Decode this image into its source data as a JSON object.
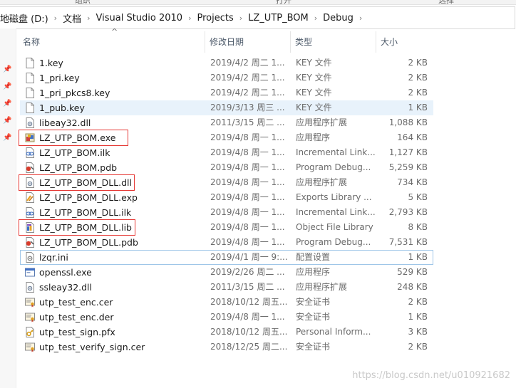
{
  "breadcrumb": [
    "地磁盘 (D:)",
    "文档",
    "Visual Studio 2010",
    "Projects",
    "LZ_UTP_BOM",
    "Debug"
  ],
  "ribbon_fragments": [
    "组织",
    "打开",
    "选择"
  ],
  "columns": {
    "name": "名称",
    "date": "修改日期",
    "type": "类型",
    "size": "大小"
  },
  "files": [
    {
      "name": "1.key",
      "date": "2019/4/2 周二 1...",
      "type": "KEY 文件",
      "size": "2 KB",
      "icon": "document-icon"
    },
    {
      "name": "1_pri.key",
      "date": "2019/4/2 周二 1...",
      "type": "KEY 文件",
      "size": "2 KB",
      "icon": "document-icon"
    },
    {
      "name": "1_pri_pkcs8.key",
      "date": "2019/4/2 周二 1...",
      "type": "KEY 文件",
      "size": "2 KB",
      "icon": "document-icon"
    },
    {
      "name": "1_pub.key",
      "date": "2019/3/13 周三 ...",
      "type": "KEY 文件",
      "size": "1 KB",
      "icon": "document-icon"
    },
    {
      "name": "libeay32.dll",
      "date": "2011/3/15 周二 ...",
      "type": "应用程序扩展",
      "size": "1,088 KB",
      "icon": "dll-icon"
    },
    {
      "name": "LZ_UTP_BOM.exe",
      "date": "2019/4/8 周一 1...",
      "type": "应用程序",
      "size": "164 KB",
      "icon": "app-exe-icon"
    },
    {
      "name": "LZ_UTP_BOM.ilk",
      "date": "2019/4/8 周一 1...",
      "type": "Incremental Link...",
      "size": "1,127 KB",
      "icon": "ilk-icon"
    },
    {
      "name": "LZ_UTP_BOM.pdb",
      "date": "2019/4/8 周一 1...",
      "type": "Program Debug...",
      "size": "5,259 KB",
      "icon": "pdb-icon"
    },
    {
      "name": "LZ_UTP_BOM_DLL.dll",
      "date": "2019/4/8 周一 1...",
      "type": "应用程序扩展",
      "size": "734 KB",
      "icon": "dll-icon"
    },
    {
      "name": "LZ_UTP_BOM_DLL.exp",
      "date": "2019/4/8 周一 1...",
      "type": "Exports Library ...",
      "size": "5 KB",
      "icon": "exp-icon"
    },
    {
      "name": "LZ_UTP_BOM_DLL.ilk",
      "date": "2019/4/8 周一 1...",
      "type": "Incremental Link...",
      "size": "2,793 KB",
      "icon": "ilk-icon"
    },
    {
      "name": "LZ_UTP_BOM_DLL.lib",
      "date": "2019/4/8 周一 1...",
      "type": "Object File Library",
      "size": "8 KB",
      "icon": "lib-icon"
    },
    {
      "name": "LZ_UTP_BOM_DLL.pdb",
      "date": "2019/4/8 周一 1...",
      "type": "Program Debug...",
      "size": "7,531 KB",
      "icon": "pdb-icon"
    },
    {
      "name": "lzqr.ini",
      "date": "2019/4/1 周一 9:...",
      "type": "配置设置",
      "size": "1 KB",
      "icon": "ini-icon"
    },
    {
      "name": "openssl.exe",
      "date": "2019/2/26 周二 ...",
      "type": "应用程序",
      "size": "529 KB",
      "icon": "window-exe-icon"
    },
    {
      "name": "ssleay32.dll",
      "date": "2011/3/15 周二 ...",
      "type": "应用程序扩展",
      "size": "248 KB",
      "icon": "dll-icon"
    },
    {
      "name": "utp_test_enc.cer",
      "date": "2018/10/12 周五...",
      "type": "安全证书",
      "size": "2 KB",
      "icon": "certificate-icon"
    },
    {
      "name": "utp_test_enc.der",
      "date": "2019/4/8 周一 1...",
      "type": "安全证书",
      "size": "1 KB",
      "icon": "certificate-icon"
    },
    {
      "name": "utp_test_sign.pfx",
      "date": "2018/10/12 周五...",
      "type": "Personal Inform...",
      "size": "3 KB",
      "icon": "pfx-icon"
    },
    {
      "name": "utp_test_verify_sign.cer",
      "date": "2018/12/25 周二...",
      "type": "安全证书",
      "size": "2 KB",
      "icon": "certificate-icon"
    }
  ],
  "watermark": "https://blog.csdn.net/u010921682"
}
